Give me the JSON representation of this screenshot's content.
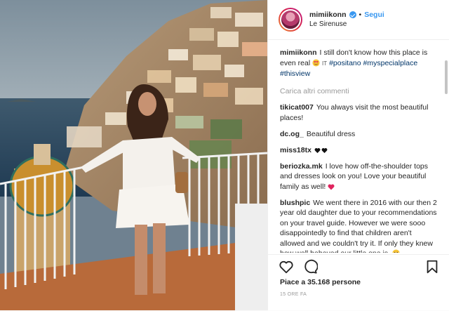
{
  "header": {
    "username": "mimiikonn",
    "separator": "•",
    "follow_label": "Segui",
    "location": "Le Sirenuse"
  },
  "caption": {
    "username": "mimiikonn",
    "text": "I still don't know how this place is even real",
    "flag": "IT",
    "hashtags": [
      "#positano",
      "#myspecialplace",
      "#thisview"
    ]
  },
  "load_more_label": "Carica altri commenti",
  "comments": [
    {
      "username": "tikicat007",
      "text": "You always visit the most beautiful places!"
    },
    {
      "username": "dc.og_",
      "text": "Beautiful dress"
    },
    {
      "username": "miss18tx",
      "text": ""
    },
    {
      "username": "beriozka.mk",
      "text": "I love how off-the-shoulder tops and dresses look on you! Love your beautiful family as well!"
    },
    {
      "username": "blushpic",
      "text": "We went there in 2016 with our then 2 year old daughter due to your recommendations on your travel guide. However we were sooo disappointedly to find that children aren't allowed and we couldn't try it. If only they knew how well behaved our little one is."
    }
  ],
  "likes_text": "Piace a 35.168 persone",
  "timestamp": "15 ORE FA",
  "colors": {
    "accent": "#3897f0",
    "hashtag": "#003569",
    "heart": "#ed4956"
  },
  "icons": [
    "verified-badge-icon",
    "heart-outline-icon",
    "comment-icon",
    "bookmark-icon"
  ]
}
